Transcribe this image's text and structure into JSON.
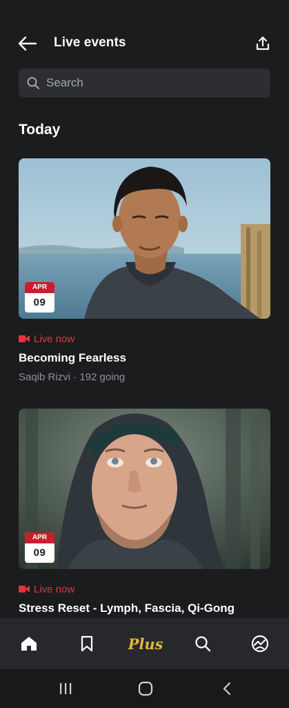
{
  "header": {
    "title": "Live events"
  },
  "search": {
    "placeholder": "Search"
  },
  "section": {
    "heading": "Today"
  },
  "events": [
    {
      "date_month": "APR",
      "date_day": "09",
      "live_label": "Live now",
      "title": "Becoming Fearless",
      "meta": "Saqib Rizvi · 192 going"
    },
    {
      "date_month": "APR",
      "date_day": "09",
      "live_label": "Live now",
      "title": "Stress Reset - Lymph, Fascia, Qi-Gong"
    }
  ],
  "bottom_nav": {
    "plus_label": "Plus",
    "items": [
      "home-icon",
      "bookmark-icon",
      "plus",
      "search-icon",
      "profile-icon"
    ]
  },
  "colors": {
    "background": "#1b1c1e",
    "live": "#e5343f",
    "plus": "#e0b73a",
    "badge_red": "#c81e2d"
  }
}
